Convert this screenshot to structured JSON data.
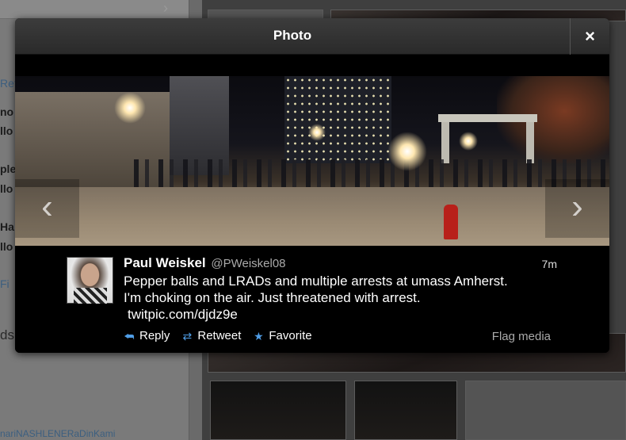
{
  "background": {
    "left_fragments": [
      "Ret",
      "no",
      "llo",
      "ple",
      "llo",
      "Ha",
      "llo",
      "Fi",
      "ds",
      "nariNASHLENERaDinKami"
    ]
  },
  "modal": {
    "title": "Photo",
    "close_label": "×",
    "prev_label": "‹",
    "next_label": "›"
  },
  "tweet": {
    "author_name": "Paul Weiskel",
    "author_handle": "@PWeiskel08",
    "time": "7m",
    "text_line1": "Pepper balls and LRADs and multiple arrests at umass Amherst.",
    "text_line2": "I'm choking on the air. Just threatened with arrest.",
    "link": "twitpic.com/djdz9e",
    "actions": {
      "reply": "Reply",
      "retweet": "Retweet",
      "favorite": "Favorite",
      "flag": "Flag media"
    }
  },
  "colors": {
    "action_icon": "#4f9de6",
    "modal_bg": "#000000"
  }
}
